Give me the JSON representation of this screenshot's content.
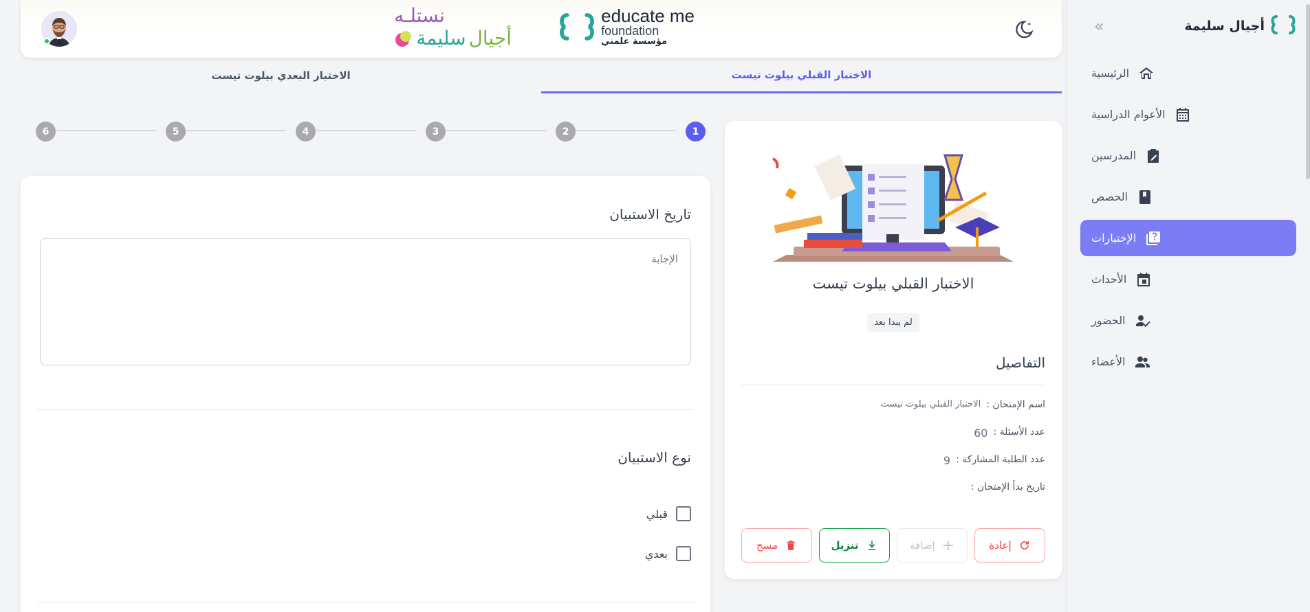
{
  "sidebar": {
    "brand": "أجيال سليمة",
    "items": [
      {
        "label": "الرئيسية",
        "icon": "home-icon"
      },
      {
        "label": "الأعوام الدراسية",
        "icon": "calendar-grid-icon"
      },
      {
        "label": "المدرسين",
        "icon": "edit-clipboard-icon"
      },
      {
        "label": "الحصص",
        "icon": "book-icon"
      },
      {
        "label": "الإختبارات",
        "icon": "quiz-icon",
        "active": true
      },
      {
        "label": "الأحداث",
        "icon": "event-icon"
      },
      {
        "label": "الحضور",
        "icon": "attendance-icon"
      },
      {
        "label": "الأعضاء",
        "icon": "people-icon"
      }
    ]
  },
  "header": {
    "logo_educate": {
      "main": "educate me",
      "sub": "foundation",
      "arabic": "مؤسسة علمني"
    },
    "logo_nastaleh": {
      "top": "نستلـه",
      "bottom_a": "أجيال",
      "bottom_b": "سليمة"
    }
  },
  "tabs": {
    "pre": "الاختبار القبلي بيلوت تيست",
    "post": "الاختبار البعدي بيلوت تيست"
  },
  "stepper": {
    "steps": [
      "1",
      "2",
      "3",
      "4",
      "5",
      "6"
    ],
    "active": "1"
  },
  "exam": {
    "title": "الاختبار القبلي بيلوت تيست",
    "status": "لم يبدا بعد",
    "details_title": "التفاصيل",
    "details": {
      "name_label": "اسم الإمتحان :",
      "name_value": "الاختبار القبلي بيلوت تيست",
      "questions_label": "عدد الأسئلة :",
      "questions_value": "60",
      "students_label": "عدد الطلبة المشاركة :",
      "students_value": "9",
      "start_label": "تاريخ بدأ الإمتحان :",
      "start_value": ""
    },
    "actions": {
      "reset": "إعادة",
      "add": "إضافة",
      "download": "تنزيل",
      "delete": "مسح"
    }
  },
  "form": {
    "q1_title": "تاريخ الاستبيان",
    "answer_placeholder": "الإجابة",
    "q2_title": "نوع الاستبيان",
    "options": [
      "قبلي",
      "بعدي"
    ]
  },
  "colors": {
    "accent": "#6b6cf3",
    "sidebar_active": "#7c7cf5",
    "danger": "#ef4444",
    "success": "#16a34a"
  }
}
